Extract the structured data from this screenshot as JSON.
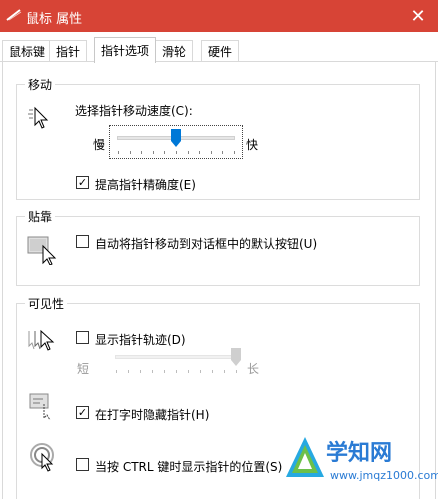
{
  "window": {
    "title": "鼠标 属性",
    "close_glyph": "✕"
  },
  "tabs": [
    {
      "label": "鼠标键"
    },
    {
      "label": "指针"
    },
    {
      "label": "指针选项"
    },
    {
      "label": "滑轮"
    },
    {
      "label": "硬件"
    }
  ],
  "active_tab": "指针选项",
  "motion": {
    "title": "移动",
    "speed_label": "选择指针移动速度(C):",
    "slow_label": "慢",
    "fast_label": "快",
    "speed_level": 0.5,
    "precision_label": "提高指针精确度(E)",
    "precision_checked": true
  },
  "snap_to": {
    "title": "贴靠",
    "label": "自动将指针移动到对话框中的默认按钮(U)",
    "checked": false
  },
  "visibility": {
    "title": "可见性",
    "trails_label": "显示指针轨迹(D)",
    "trails_checked": false,
    "short_label": "短",
    "long_label": "长",
    "trail_level": 1.0,
    "hide_label": "在打字时隐藏指针(H)",
    "hide_checked": true,
    "ctrl_label": "当按 CTRL 键时显示指针的位置(S)",
    "ctrl_checked": false
  },
  "watermark": {
    "text": "学知网",
    "url": "www.jmqz1000.com"
  },
  "colors": {
    "titlebar": "#d74436",
    "accent": "#0078d7"
  }
}
